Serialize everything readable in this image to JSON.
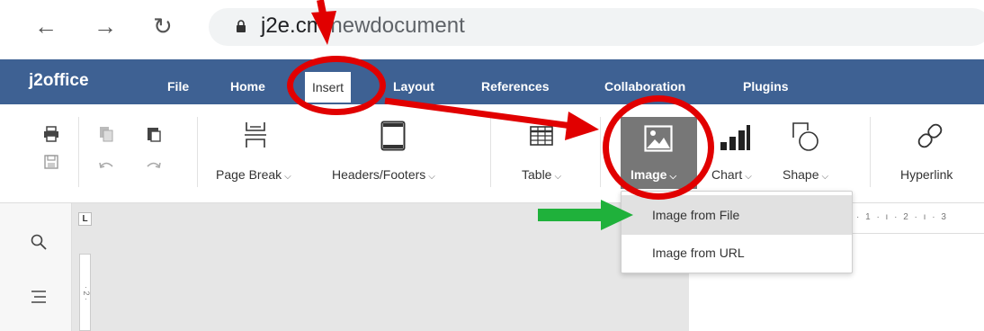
{
  "browser": {
    "url_host": "j2e.c",
    "url_host_tail": "m",
    "url_path": "/newdocument"
  },
  "app": {
    "logo": "j2office",
    "menu": [
      {
        "label": "File"
      },
      {
        "label": "Home"
      },
      {
        "label": "Insert",
        "active": true
      },
      {
        "label": "Layout"
      },
      {
        "label": "References"
      },
      {
        "label": "Collaboration"
      },
      {
        "label": "Plugins"
      }
    ]
  },
  "toolbar": {
    "page_break": "Page Break",
    "headers_footers": "Headers/Footers",
    "table": "Table",
    "image": "Image",
    "chart": "Chart",
    "shape": "Shape",
    "hyperlink": "Hyperlink"
  },
  "dropdown": {
    "items": [
      {
        "label": "Image from File",
        "highlighted": true
      },
      {
        "label": "Image from URL",
        "highlighted": false
      }
    ]
  },
  "editor": {
    "ruler_corner": "L",
    "hruler_ticks": "· 1 · ı · 2 · ı · 3",
    "vruler_ticks": "· 2 ·"
  },
  "annotations": {
    "circle_color": "#e10000",
    "arrow_red": "#e10000",
    "arrow_green": "#1fb13b"
  }
}
